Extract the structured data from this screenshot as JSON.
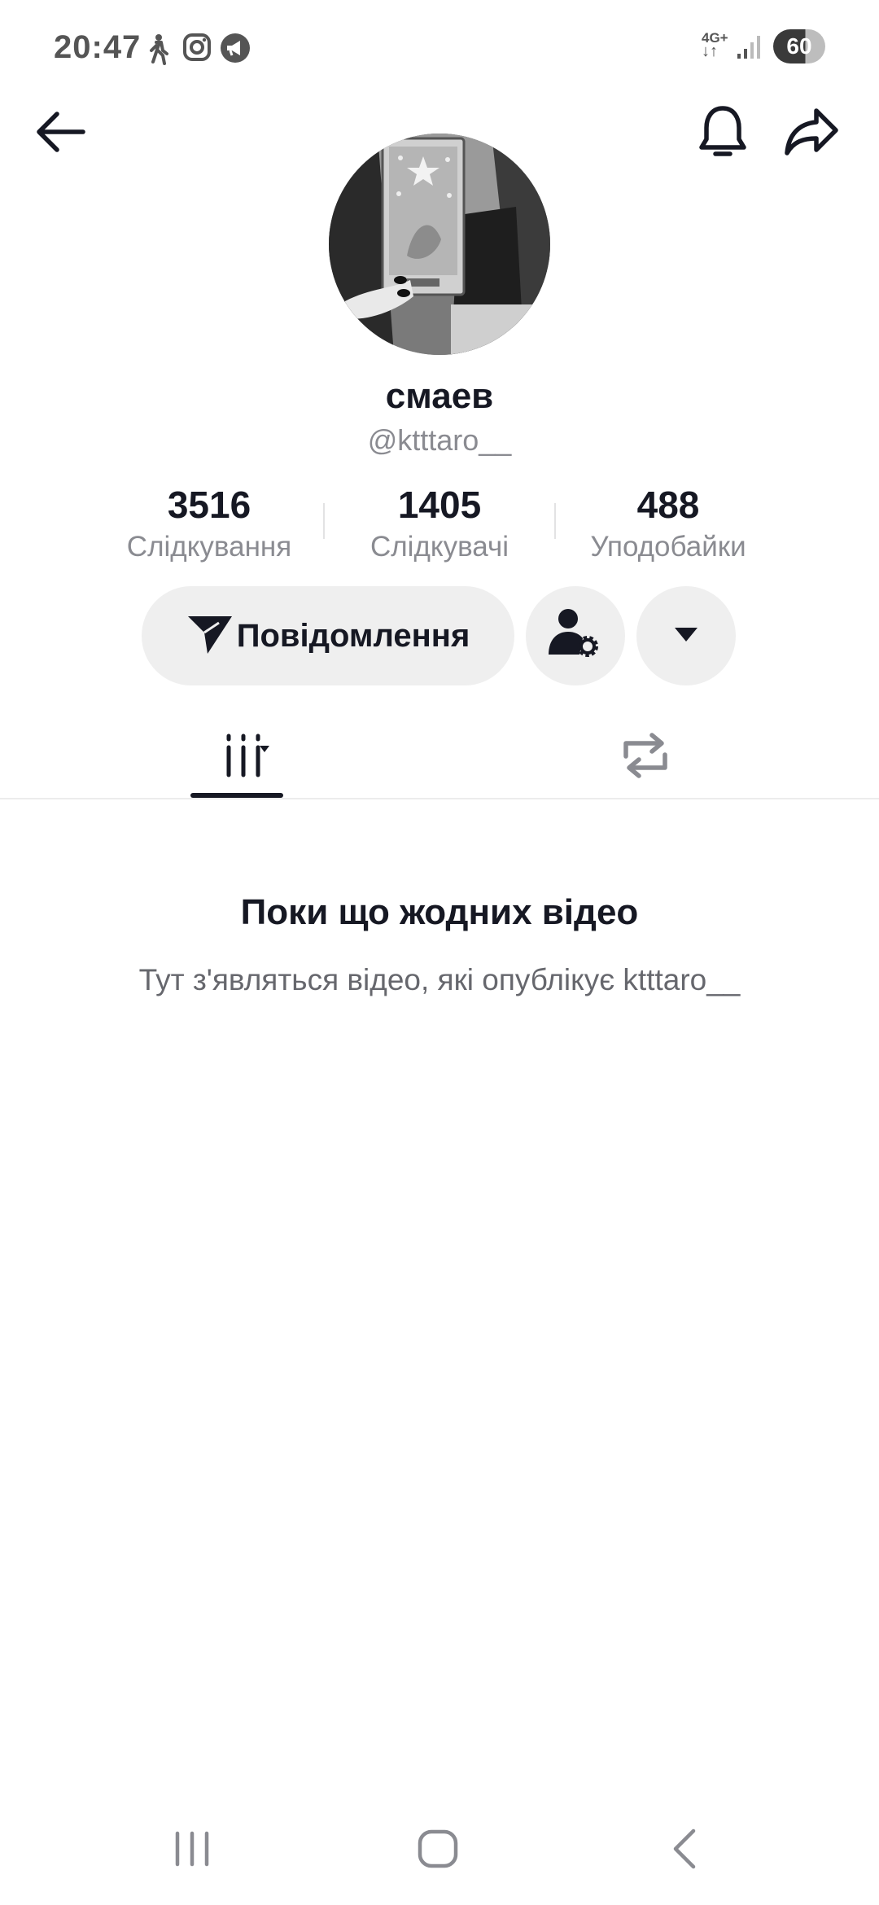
{
  "status_bar": {
    "time": "20:47",
    "network": "4G+",
    "battery": "60",
    "icons": [
      "walking-icon",
      "instagram-icon",
      "megaphone-icon",
      "signal-icon"
    ]
  },
  "header": {
    "back_icon": "arrow-left-icon",
    "notification_icon": "bell-icon",
    "share_icon": "share-icon"
  },
  "profile": {
    "display_name": "смаев",
    "username": "@ktttaro__",
    "stats": [
      {
        "value": "3516",
        "label": "Слідкування"
      },
      {
        "value": "1405",
        "label": "Слідкувачі"
      },
      {
        "value": "488",
        "label": "Уподобайки"
      }
    ]
  },
  "actions": {
    "message_label": "Повідомлення",
    "message_icon": "send-icon",
    "follow_settings_icon": "user-settings-icon",
    "more_icon": "caret-down-icon"
  },
  "tabs": [
    {
      "icon": "videos-grid-icon",
      "active": true
    },
    {
      "icon": "repost-icon",
      "active": false
    }
  ],
  "empty_state": {
    "title": "Поки що жодних відео",
    "description": "Тут з'являться відео, які опублікує ktttaro__"
  },
  "nav_bar": [
    "recents-icon",
    "home-icon",
    "back-icon"
  ],
  "colors": {
    "text": "#161823",
    "secondary": "#8a8b91",
    "button_bg": "#efefef",
    "background": "#ffffff"
  }
}
